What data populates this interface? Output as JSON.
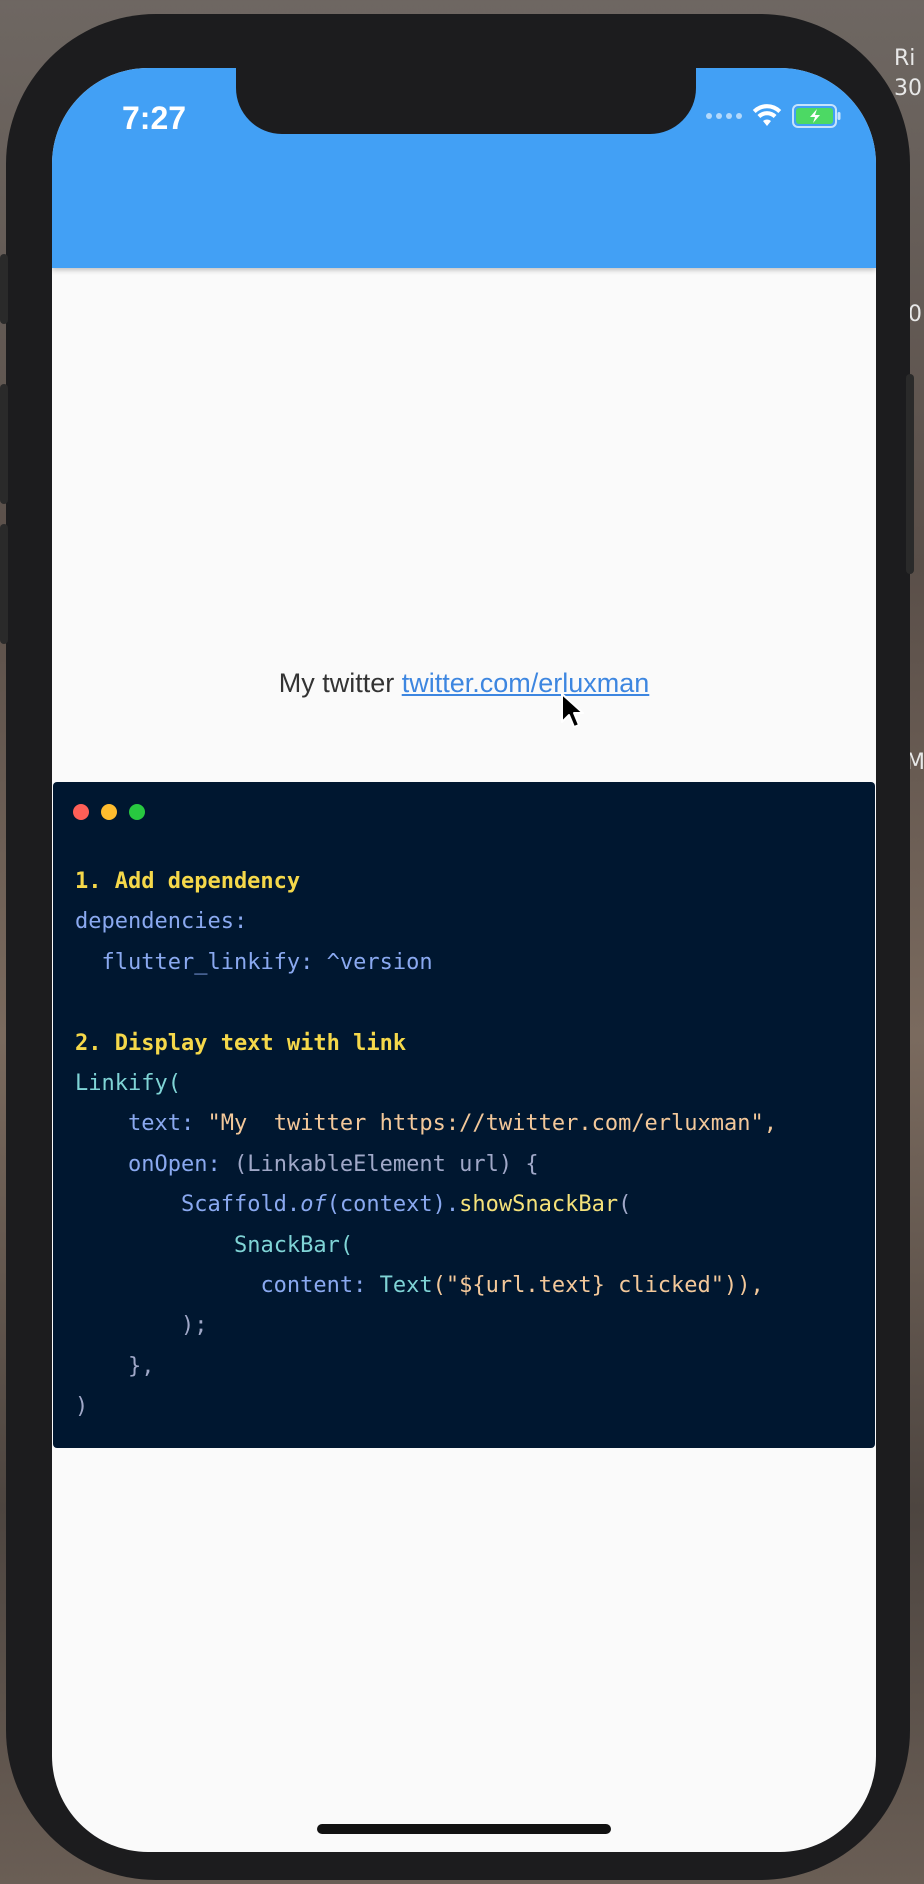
{
  "desktop": {
    "text_a": "Ri",
    "text_b": "30",
    "text_c": "0",
    "text_d": "Me"
  },
  "status_bar": {
    "time": "7:27",
    "icons": [
      "cellular-dots-icon",
      "wifi-icon",
      "battery-charging-icon"
    ],
    "battery_color": "#4cd964"
  },
  "app_bar": {
    "color": "#42a0f5"
  },
  "content": {
    "text_prefix": "My  twitter ",
    "link_text": "twitter.com/erluxman",
    "link_color": "#3d86e0"
  },
  "code_window": {
    "background": "#001730",
    "traffic_lights": [
      "#fe5f57",
      "#febc2e",
      "#28c840"
    ],
    "step1": "1. Add dependency",
    "dep_key": "dependencies:",
    "dep_pkg": "flutter_linkify: ^version",
    "step2": "2. Display text with link",
    "l_linkify": "Linkify(",
    "l_text_key": "text:",
    "l_text_val": "\"My  twitter https://twitter.com/erluxman\",",
    "l_onopen": "onOpen:",
    "l_onopen_args": "(LinkableElement url) {",
    "l_scaffold": "Scaffold.",
    "l_of": "of",
    "l_context": "(context).",
    "l_show": "showSnackBar",
    "l_paren": "(",
    "l_snackbar": "SnackBar(",
    "l_content": "content:",
    "l_textcls": "Text",
    "l_textarg": "(\"${url.text} clicked\")),",
    "l_close1": ");",
    "l_close2": "},",
    "l_close3": ")"
  }
}
